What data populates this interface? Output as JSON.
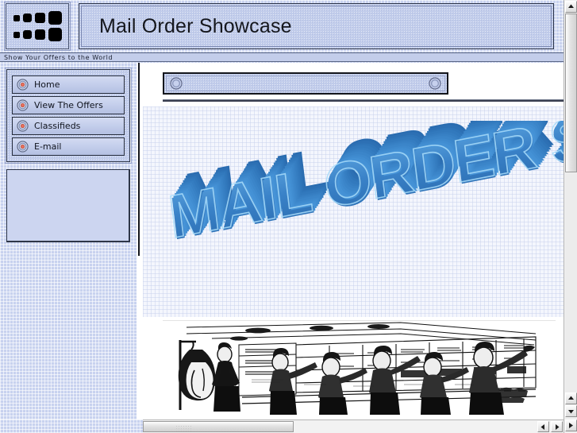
{
  "header": {
    "title": "Mail Order Showcase",
    "logo_icon": "squares-grid-logo"
  },
  "tagline": {
    "text": "Show Your Offers to the World"
  },
  "sidebar": {
    "nav_items": [
      {
        "label": "Home",
        "icon": "bullseye-icon"
      },
      {
        "label": "View The Offers",
        "icon": "bullseye-icon"
      },
      {
        "label": "Classifieds",
        "icon": "bullseye-icon"
      },
      {
        "label": "E-mail",
        "icon": "bullseye-icon"
      }
    ],
    "empty_panel_label": ""
  },
  "content": {
    "banner": {
      "left_icon": "ring-icon",
      "right_icon": "ring-icon",
      "text": ""
    },
    "hero": {
      "heading_3d": "MAIL ORDER SHOWCASE",
      "visible_text": "MAIL ORDER SHOW",
      "style": "blue-extruded-3d-perspective"
    },
    "photo": {
      "alt": "vintage engraving of workers filling mail order shelves in a warehouse",
      "style": "black-and-white-line-engraving"
    }
  },
  "scrollbars": {
    "vertical": {
      "up_arrow": "▲",
      "down_arrow": "▼",
      "cursor_glyph": "▶"
    },
    "horizontal": {
      "left_arrow": "◀",
      "right_arrow": "▶"
    }
  },
  "colors": {
    "accent_blue": "#c3cdea",
    "title_text": "#14161c",
    "bullseye_center": "#e8705e",
    "hero_blue": "#2f7cc4",
    "frame_dark": "#14161c"
  }
}
